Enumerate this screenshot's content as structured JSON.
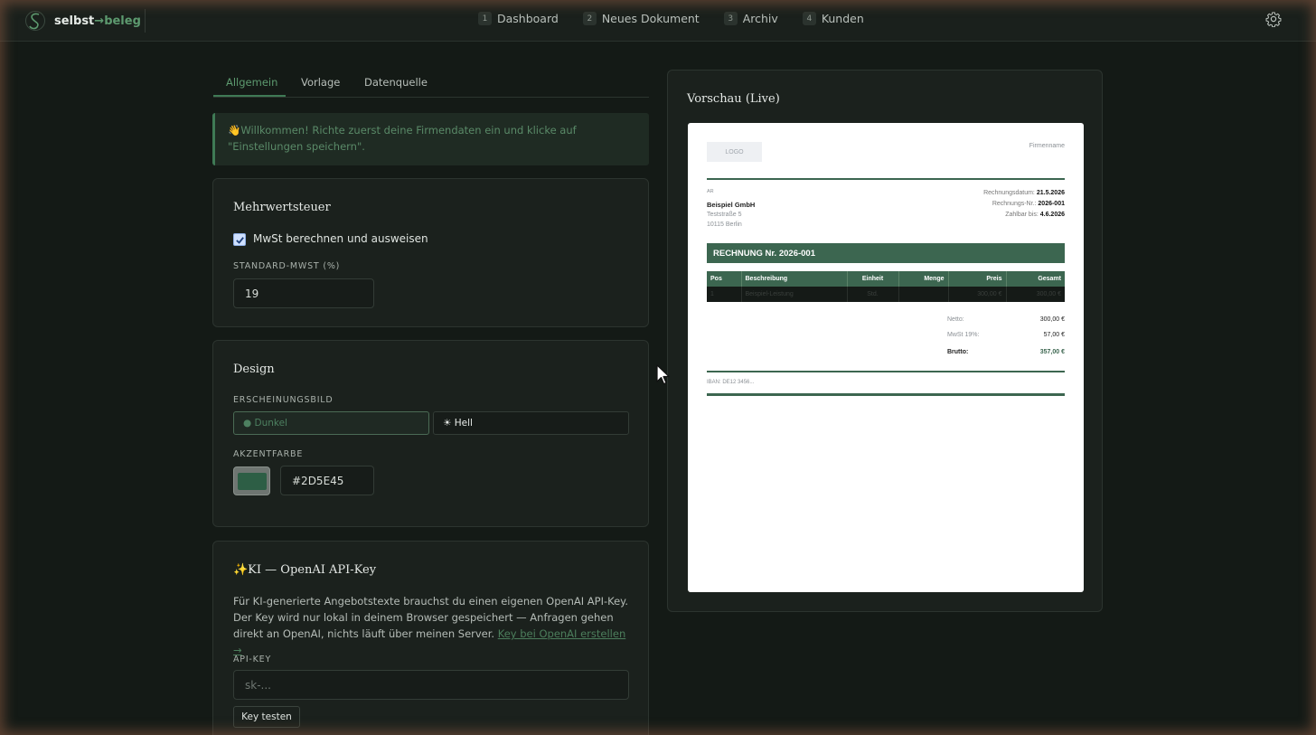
{
  "brand": {
    "part1": "selbst",
    "arrow": "→",
    "part2": "beleg"
  },
  "nav": [
    {
      "num": "1",
      "label": "Dashboard"
    },
    {
      "num": "2",
      "label": "Neues Dokument"
    },
    {
      "num": "3",
      "label": "Archiv"
    },
    {
      "num": "4",
      "label": "Kunden"
    }
  ],
  "tabs": {
    "general": "Allgemein",
    "template": "Vorlage",
    "datasource": "Datenquelle",
    "active": "Allgemein"
  },
  "welcome": {
    "emoji": "👋",
    "text": "Willkommen! Richte zuerst deine Firmendaten ein und klicke auf \"Einstellungen speichern\"."
  },
  "vat": {
    "title": "Mehrwertsteuer",
    "checkbox_label": "MwSt berechnen und ausweisen",
    "checkbox_checked": true,
    "rate_label": "STANDARD-MWST (%)",
    "rate_value": "19"
  },
  "design": {
    "title": "Design",
    "appearance_label": "ERSCHEINUNGSBILD",
    "dark_label": "● Dunkel",
    "light_label": "☀ Hell",
    "selected": "Dunkel",
    "accent_label": "AKZENTFARBE",
    "accent_value": "#2D5E45",
    "accent_color": "#2d5e45"
  },
  "ai": {
    "title": "✨KI — OpenAI API-Key",
    "description": "Für KI-generierte Angebotstexte brauchst du einen eigenen OpenAI API-Key. Der Key wird nur lokal in deinem Browser gespeichert — Anfragen gehen direkt an OpenAI, nichts läuft über meinen Server. ",
    "link_text": "Key bei OpenAI erstellen →",
    "key_label": "API-KEY",
    "key_placeholder": "sk-...",
    "test_button": "Key testen"
  },
  "preview": {
    "title": "Vorschau (Live)",
    "logo": "LOGO",
    "company_name": "Firmenname",
    "sender_short": "AR",
    "recipient_name": "Beispiel GmbH",
    "recipient_street": "Teststraße 5",
    "recipient_city": "10115 Berlin",
    "invoice_date_label": "Rechnungsdatum:",
    "invoice_date": "21.5.2026",
    "invoice_no_label": "Rechnungs-Nr.:",
    "invoice_no": "2026-001",
    "due_label": "Zahlbar bis:",
    "due_date": "4.6.2026",
    "banner": "RECHNUNG Nr. 2026-001",
    "table_headers": [
      "Pos",
      "Beschreibung",
      "Einheit",
      "Menge",
      "Preis",
      "Gesamt"
    ],
    "table_row": [
      "1",
      "Beispiel-Leistung",
      "Std.",
      "",
      "300,00 €",
      "300,00 €"
    ],
    "net_label": "Netto:",
    "net_value": "300,00 €",
    "vat_label": "MwSt 19%:",
    "vat_value": "57,00 €",
    "gross_label": "Brutto:",
    "gross_value": "357,00 €",
    "iban": "IBAN: DE12 3456..."
  }
}
